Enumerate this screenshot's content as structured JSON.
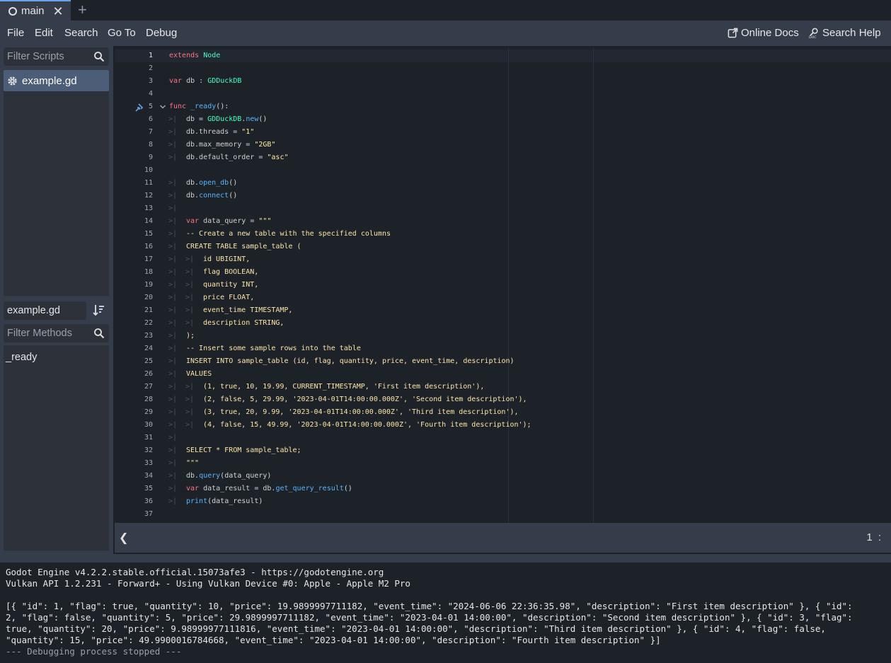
{
  "tabs": [
    {
      "label": "main",
      "close": "✕"
    }
  ],
  "tab_add": "+",
  "menu": {
    "items": [
      "File",
      "Edit",
      "Search",
      "Go To",
      "Debug"
    ],
    "online_docs": "Online Docs",
    "search_help": "Search Help"
  },
  "scripts_panel": {
    "filter_placeholder": "Filter Scripts",
    "scripts": [
      "example.gd"
    ],
    "current_script": "example.gd",
    "methods_placeholder": "Filter Methods",
    "methods": [
      "_ready"
    ]
  },
  "code_lines": [
    {
      "n": "1",
      "tabs": 0,
      "segs": [
        [
          "kw",
          "extends"
        ],
        [
          "t",
          " "
        ],
        [
          "ty",
          "Node"
        ]
      ]
    },
    {
      "n": "2",
      "tabs": 0,
      "segs": []
    },
    {
      "n": "3",
      "tabs": 0,
      "segs": [
        [
          "kw",
          "var"
        ],
        [
          "t",
          " "
        ],
        [
          "ident",
          "db : "
        ],
        [
          "ty",
          "GDDuckDB"
        ]
      ]
    },
    {
      "n": "4",
      "tabs": 0,
      "segs": []
    },
    {
      "n": "5",
      "tabs": 0,
      "segs": [
        [
          "kw",
          "func"
        ],
        [
          "t",
          " "
        ],
        [
          "fn",
          "_ready"
        ],
        [
          "t",
          "():"
        ]
      ]
    },
    {
      "n": "6",
      "tabs": 1,
      "segs": [
        [
          "ident",
          "db = "
        ],
        [
          "ty",
          "GDDuckDB"
        ],
        [
          "t",
          "."
        ],
        [
          "fn",
          "new"
        ],
        [
          "t",
          "()"
        ]
      ]
    },
    {
      "n": "7",
      "tabs": 1,
      "segs": [
        [
          "ident",
          "db.threads = "
        ],
        [
          "str",
          "\"1\""
        ]
      ]
    },
    {
      "n": "8",
      "tabs": 1,
      "segs": [
        [
          "ident",
          "db.max_memory = "
        ],
        [
          "str",
          "\"2GB\""
        ]
      ]
    },
    {
      "n": "9",
      "tabs": 1,
      "segs": [
        [
          "ident",
          "db.default_order = "
        ],
        [
          "str",
          "\"asc\""
        ]
      ]
    },
    {
      "n": "10",
      "tabs": 0,
      "segs": []
    },
    {
      "n": "11",
      "tabs": 1,
      "segs": [
        [
          "ident",
          "db."
        ],
        [
          "fn",
          "open_db"
        ],
        [
          "t",
          "()"
        ]
      ]
    },
    {
      "n": "12",
      "tabs": 1,
      "segs": [
        [
          "ident",
          "db."
        ],
        [
          "fn",
          "connect"
        ],
        [
          "t",
          "()"
        ]
      ]
    },
    {
      "n": "13",
      "tabs": 1,
      "segs": []
    },
    {
      "n": "14",
      "tabs": 1,
      "segs": [
        [
          "kw",
          "var"
        ],
        [
          "t",
          " "
        ],
        [
          "ident",
          "data_query = "
        ],
        [
          "str",
          "\"\"\""
        ]
      ]
    },
    {
      "n": "15",
      "tabs": 1,
      "segs": [
        [
          "sql",
          "-- Create a new table with the specified columns"
        ]
      ]
    },
    {
      "n": "16",
      "tabs": 1,
      "segs": [
        [
          "sql",
          "CREATE TABLE sample_table ("
        ]
      ]
    },
    {
      "n": "17",
      "tabs": 2,
      "segs": [
        [
          "sql",
          "id UBIGINT,"
        ]
      ]
    },
    {
      "n": "18",
      "tabs": 2,
      "segs": [
        [
          "sql",
          "flag BOOLEAN,"
        ]
      ]
    },
    {
      "n": "19",
      "tabs": 2,
      "segs": [
        [
          "sql",
          "quantity INT,"
        ]
      ]
    },
    {
      "n": "20",
      "tabs": 2,
      "segs": [
        [
          "sql",
          "price FLOAT,"
        ]
      ]
    },
    {
      "n": "21",
      "tabs": 2,
      "segs": [
        [
          "sql",
          "event_time TIMESTAMP,"
        ]
      ]
    },
    {
      "n": "22",
      "tabs": 2,
      "segs": [
        [
          "sql",
          "description STRING,"
        ]
      ]
    },
    {
      "n": "23",
      "tabs": 1,
      "segs": [
        [
          "sql",
          ");"
        ]
      ]
    },
    {
      "n": "24",
      "tabs": 1,
      "segs": [
        [
          "sql",
          "-- Insert some sample rows into the table"
        ]
      ]
    },
    {
      "n": "25",
      "tabs": 1,
      "segs": [
        [
          "sql",
          "INSERT INTO sample_table (id, flag, quantity, price, event_time, description)"
        ]
      ]
    },
    {
      "n": "26",
      "tabs": 1,
      "segs": [
        [
          "sql",
          "VALUES"
        ]
      ]
    },
    {
      "n": "27",
      "tabs": 2,
      "segs": [
        [
          "sql",
          "(1, true, 10, 19.99, CURRENT_TIMESTAMP, 'First item description'),"
        ]
      ]
    },
    {
      "n": "28",
      "tabs": 2,
      "segs": [
        [
          "sql",
          "(2, false, 5, 29.99, '2023-04-01T14:00:00.000Z', 'Second item description'),"
        ]
      ]
    },
    {
      "n": "29",
      "tabs": 2,
      "segs": [
        [
          "sql",
          "(3, true, 20, 9.99, '2023-04-01T14:00:00.000Z', 'Third item description'),"
        ]
      ]
    },
    {
      "n": "30",
      "tabs": 2,
      "segs": [
        [
          "sql",
          "(4, false, 15, 49.99, '2023-04-01T14:00:00.000Z', 'Fourth item description');"
        ]
      ]
    },
    {
      "n": "31",
      "tabs": 1,
      "segs": []
    },
    {
      "n": "32",
      "tabs": 1,
      "segs": [
        [
          "sql",
          "SELECT * FROM sample_table;"
        ]
      ]
    },
    {
      "n": "33",
      "tabs": 1,
      "segs": [
        [
          "str",
          "\"\"\""
        ]
      ]
    },
    {
      "n": "34",
      "tabs": 1,
      "segs": [
        [
          "ident",
          "db."
        ],
        [
          "fn",
          "query"
        ],
        [
          "t",
          "(data_query)"
        ]
      ]
    },
    {
      "n": "35",
      "tabs": 1,
      "segs": [
        [
          "kw",
          "var"
        ],
        [
          "t",
          " "
        ],
        [
          "ident",
          "data_result = db."
        ],
        [
          "fn",
          "get_query_result"
        ],
        [
          "t",
          "()"
        ]
      ]
    },
    {
      "n": "36",
      "tabs": 1,
      "segs": [
        [
          "fn",
          "print"
        ],
        [
          "t",
          "(data_result)"
        ]
      ]
    },
    {
      "n": "37",
      "tabs": 0,
      "segs": []
    }
  ],
  "status": {
    "toggle": "❮",
    "cursor": "1 :"
  },
  "output": {
    "lines": [
      "Godot Engine v4.2.2.stable.official.15073afe3 - https://godotengine.org",
      "Vulkan API 1.2.231 - Forward+ - Using Vulkan Device #0: Apple - Apple M2 Pro",
      "",
      "[{ \"id\": 1, \"flag\": true, \"quantity\": 10, \"price\": 19.9899997711182, \"event_time\": \"2024-06-06 22:36:35.98\", \"description\": \"First item description\" }, { \"id\":",
      "2, \"flag\": false, \"quantity\": 5, \"price\": 29.9899997711182, \"event_time\": \"2023-04-01 14:00:00\", \"description\": \"Second item description\" }, { \"id\": 3, \"flag\":",
      "true, \"quantity\": 20, \"price\": 9.98999977111816, \"event_time\": \"2023-04-01 14:00:00\", \"description\": \"Third item description\" }, { \"id\": 4, \"flag\": false,",
      "\"quantity\": 15, \"price\": 49.9900016784668, \"event_time\": \"2023-04-01 14:00:00\", \"description\": \"Fourth item description\" }]"
    ],
    "stopped": "--- Debugging process stopped ---"
  }
}
